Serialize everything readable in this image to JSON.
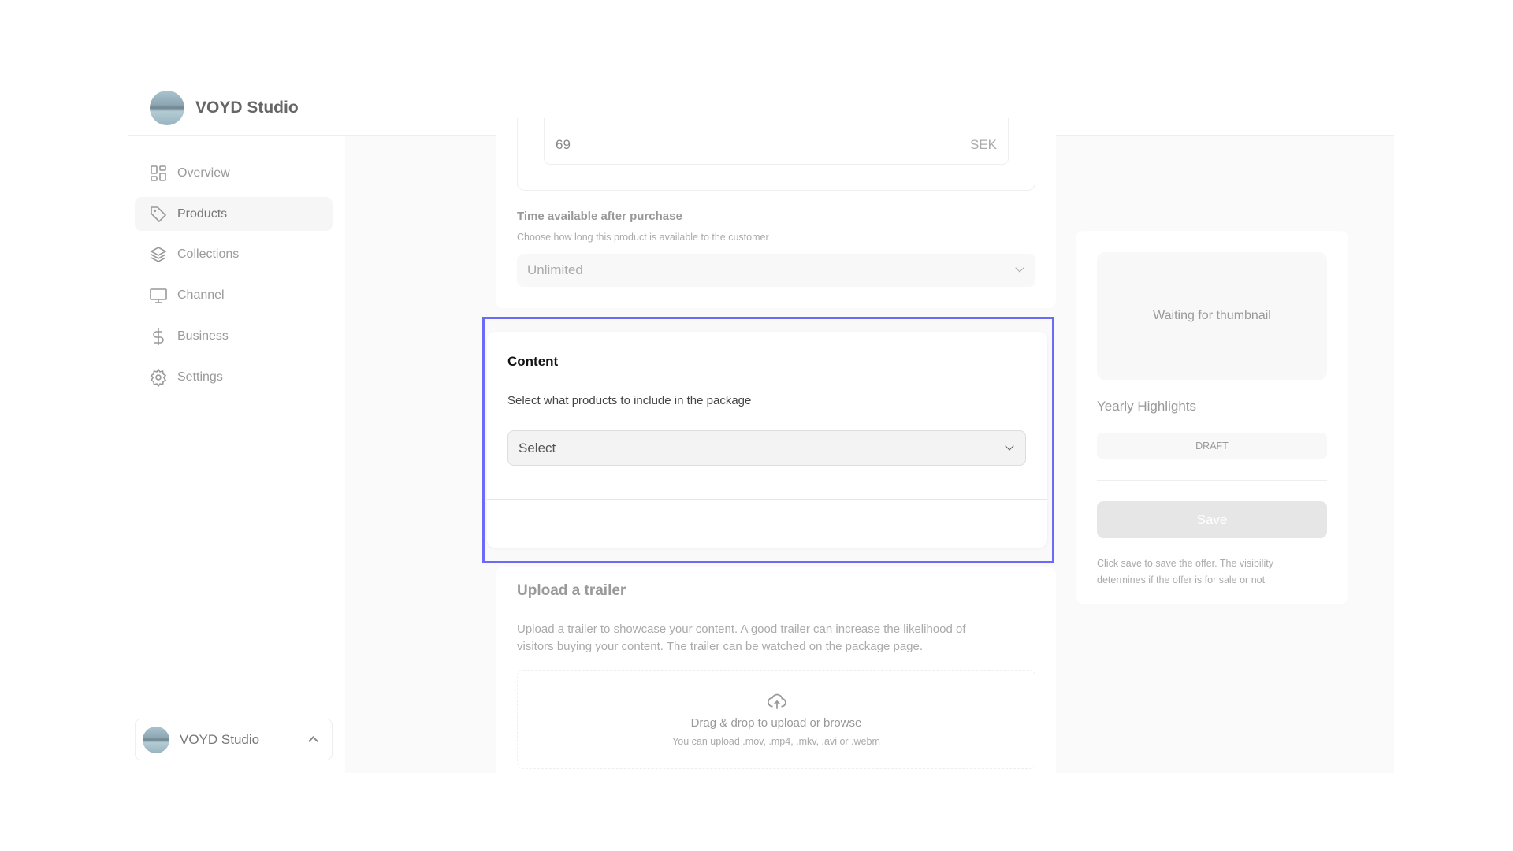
{
  "app": {
    "name": "VOYD Studio"
  },
  "sidebar": {
    "items": [
      {
        "label": "Overview",
        "icon": "grid-icon"
      },
      {
        "label": "Products",
        "icon": "tag-icon",
        "active": true
      },
      {
        "label": "Collections",
        "icon": "layers-icon"
      },
      {
        "label": "Channel",
        "icon": "monitor-icon"
      },
      {
        "label": "Business",
        "icon": "dollar-icon"
      },
      {
        "label": "Settings",
        "icon": "gear-icon"
      }
    ],
    "account": {
      "name": "VOYD Studio"
    }
  },
  "price": {
    "value": "69",
    "currency": "SEK"
  },
  "availability": {
    "title": "Time available after purchase",
    "subtitle": "Choose how long this product is available to the customer",
    "value": "Unlimited"
  },
  "content": {
    "title": "Content",
    "subtitle": "Select what products to include in the package",
    "placeholder": "Select",
    "highlight_color": "#6b6bf7"
  },
  "trailer": {
    "title": "Upload a trailer",
    "description_line1": "Upload a trailer to showcase your content. A good trailer can increase the likelihood of",
    "description_line2": "visitors buying your content. The trailer can be watched on the package page.",
    "drop_text": "Drag & drop to upload or browse",
    "formats": "You can upload .mov, .mp4, .mkv, .avi or .webm"
  },
  "summary": {
    "thumbnail_text": "Waiting for thumbnail",
    "name": "Yearly Highlights",
    "status": "DRAFT",
    "save_label": "Save",
    "note_line1": "Click save to save the offer. The visibility",
    "note_line2": "determines if the offer is for sale or not"
  }
}
